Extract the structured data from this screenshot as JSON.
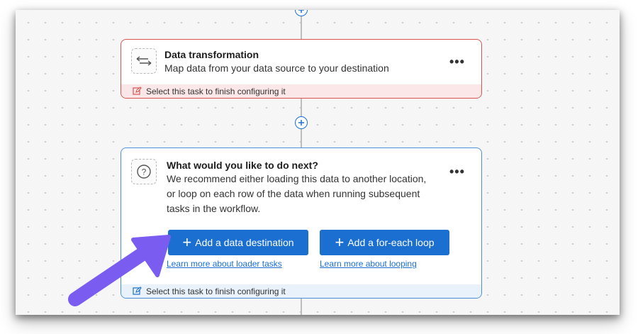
{
  "transformation_card": {
    "title": "Data transformation",
    "description": "Map data from your data source to your destination",
    "footer_text": "Select this task to finish configuring it",
    "menu_label": "•••"
  },
  "next_step_card": {
    "title": "What would you like to do next?",
    "description_lines": [
      "We recommend either loading this data to another location,",
      "or loop on each row of the data when running subsequent",
      "tasks in the workflow."
    ],
    "menu_label": "•••",
    "destination_button": "Add a data destination",
    "loop_button": "Add a for-each loop",
    "destination_link": "Learn more about loader tasks",
    "loop_link": "Learn more about looping",
    "footer_text": "Select this task to finish configuring it"
  },
  "colors": {
    "accent": "#1a6fd1",
    "error_border": "#d9534f",
    "active_border": "#4a90d9",
    "arrow": "#7b5cf0"
  }
}
